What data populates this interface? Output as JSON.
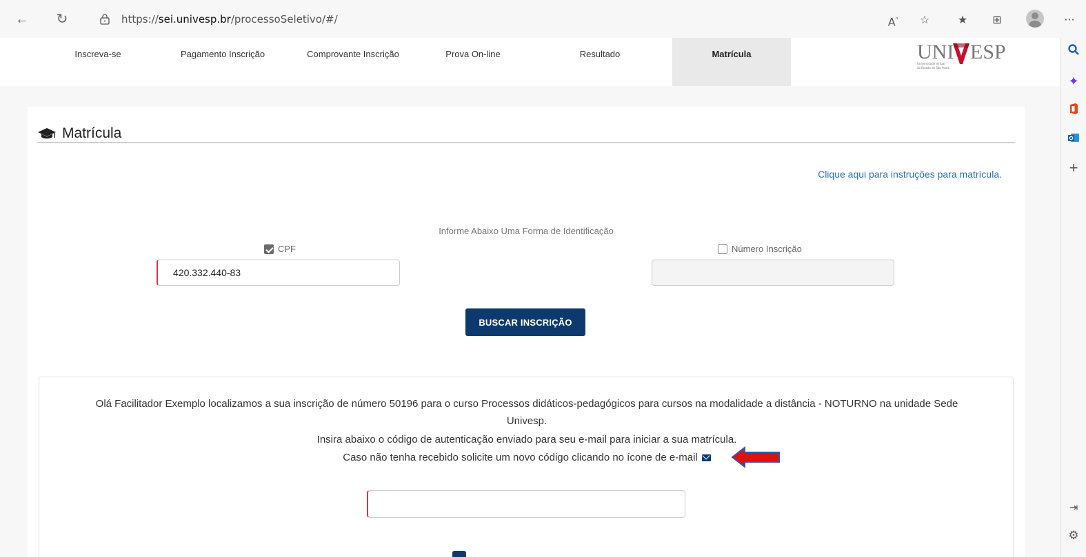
{
  "browser": {
    "url_prefix": "https://",
    "url_domain": "sei.univesp.br",
    "url_path": "/processoSeletivo/#/",
    "read_aloud_glyph": "A",
    "more_glyph": "···"
  },
  "nav": {
    "tabs": [
      {
        "label": "Inscreva-se"
      },
      {
        "label": "Pagamento Inscrição"
      },
      {
        "label": "Comprovante Inscrição"
      },
      {
        "label": "Prova On-line"
      },
      {
        "label": "Resultado"
      },
      {
        "label": "Matrícula"
      }
    ],
    "logo_text_left": "UNI",
    "logo_text_right": "ESP",
    "logo_subtitle_1": "Universidade Virtual",
    "logo_subtitle_2": "do Estado de São Paulo"
  },
  "page": {
    "title": "Matrícula",
    "instructions_link": "Clique aqui para instruções para matrícula.",
    "ident_prompt": "Informe Abaixo Uma Forma de Identificação",
    "cpf_label": "CPF",
    "cpf_checked": true,
    "cpf_value": "420.332.440-83",
    "inscricao_label": "Número Inscrição",
    "inscricao_checked": false,
    "inscricao_value": "",
    "search_button": "BUSCAR INSCRIÇÃO"
  },
  "result": {
    "line1": "Olá Facilitador Exemplo localizamos a sua inscrição de número 50196 para o curso Processos didáticos-pedagógicos para cursos na modalidade a distância - NOTURNO na unidade Sede",
    "line2": "Univesp.",
    "line3": "Insira abaixo o código de autenticação enviado para seu e-mail para iniciar a sua matrícula.",
    "line4": "Caso não tenha recebido solicite um novo código clicando no ícone de e-mail",
    "code_value": ""
  },
  "colors": {
    "primary": "#0d3a6e",
    "link": "#2a6fb5",
    "arrow": "#e01010"
  }
}
